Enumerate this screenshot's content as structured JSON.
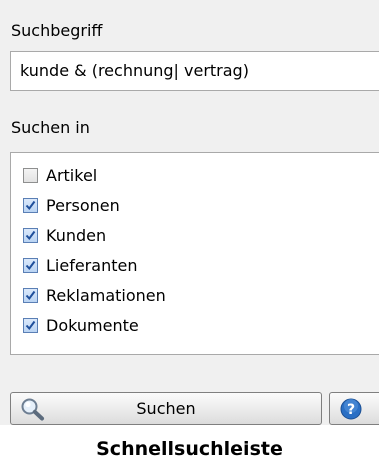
{
  "search": {
    "label": "Suchbegriff",
    "value": "kunde & (rechnung| vertrag)"
  },
  "search_in": {
    "label": "Suchen in",
    "options": [
      {
        "label": "Artikel",
        "checked": false
      },
      {
        "label": "Personen",
        "checked": true
      },
      {
        "label": "Kunden",
        "checked": true
      },
      {
        "label": "Lieferanten",
        "checked": true
      },
      {
        "label": "Reklamationen",
        "checked": true
      },
      {
        "label": "Dokumente",
        "checked": true
      }
    ]
  },
  "buttons": {
    "search_label": "Suchen",
    "search_icon": "magnifier-icon",
    "help_icon": "help-icon"
  },
  "caption": "Schnellsuchleiste",
  "colors": {
    "panel_bg": "#f0f0f0",
    "border": "#a9a9a9",
    "check_blue": "#1f4f9c",
    "help_blue": "#2a6fc4"
  }
}
